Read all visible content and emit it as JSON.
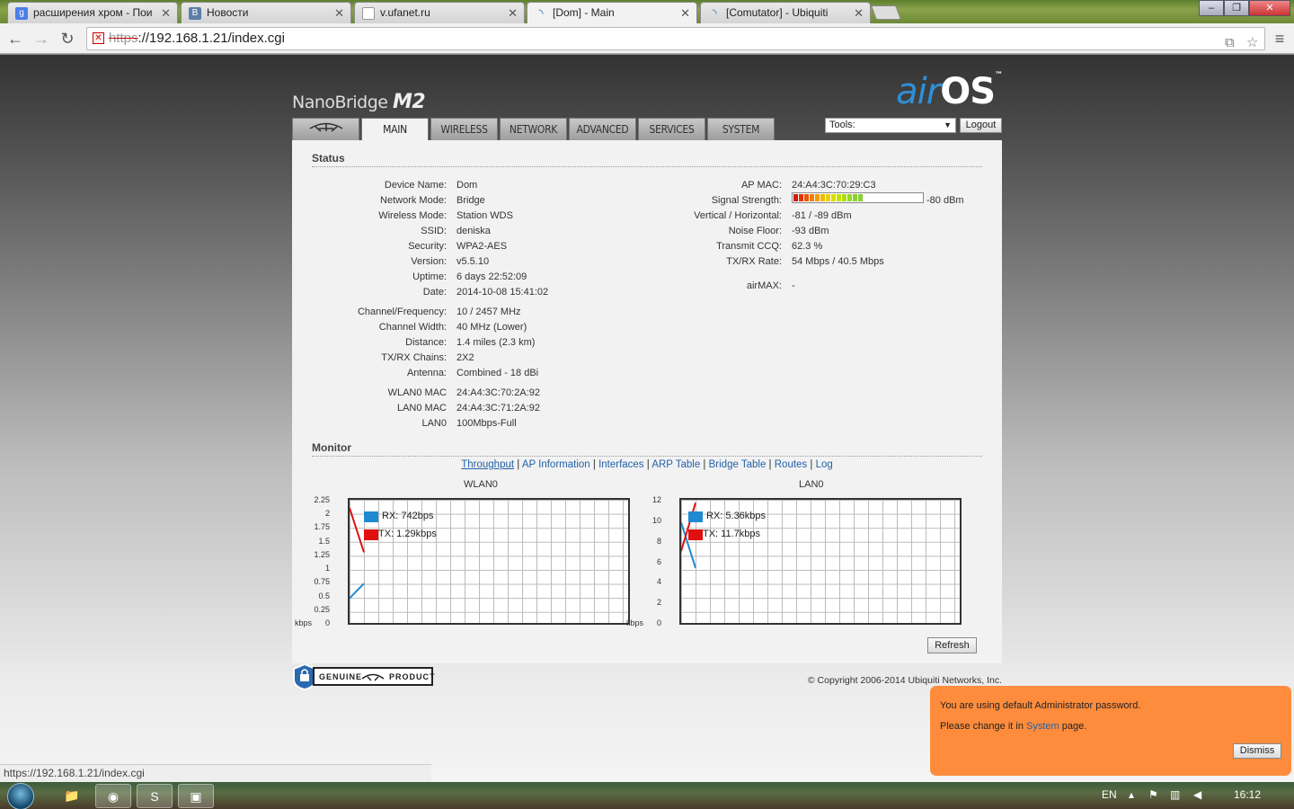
{
  "browser": {
    "tabs": [
      {
        "label": "расширения хром - Пои",
        "icon": "google-icon"
      },
      {
        "label": "Новости",
        "icon": "vk-icon"
      },
      {
        "label": "v.ufanet.ru",
        "icon": "page-icon"
      },
      {
        "label": "[Dom] - Main",
        "icon": "rss-icon",
        "active": true
      },
      {
        "label": "[Comutator] - Ubiquiti",
        "icon": "rss-icon"
      }
    ],
    "url_proto": "https",
    "url_rest": "://192.168.1.21/index.cgi",
    "status_url": "https://192.168.1.21/index.cgi"
  },
  "header": {
    "brand": "NanoBridge",
    "model": "M2",
    "logo_air": "air",
    "logo_os": "OS",
    "tm": "™"
  },
  "nav": {
    "tabs": [
      "MAIN",
      "WIRELESS",
      "NETWORK",
      "ADVANCED",
      "SERVICES",
      "SYSTEM"
    ],
    "tools": "Tools:",
    "logout": "Logout"
  },
  "status": {
    "title": "Status",
    "left": [
      {
        "label": "Device Name:",
        "value": "Dom"
      },
      {
        "label": "Network Mode:",
        "value": "Bridge"
      },
      {
        "label": "Wireless Mode:",
        "value": "Station WDS"
      },
      {
        "label": "SSID:",
        "value": "deniska"
      },
      {
        "label": "Security:",
        "value": "WPA2-AES"
      },
      {
        "label": "Version:",
        "value": "v5.5.10"
      },
      {
        "label": "Uptime:",
        "value": "6 days 22:52:09"
      },
      {
        "label": "Date:",
        "value": "2014-10-08 15:41:02"
      },
      {
        "label": "Channel/Frequency:",
        "value": "10 / 2457 MHz"
      },
      {
        "label": "Channel Width:",
        "value": "40 MHz (Lower)"
      },
      {
        "label": "Distance:",
        "value": "1.4 miles (2.3 km)"
      },
      {
        "label": "TX/RX Chains:",
        "value": "2X2"
      },
      {
        "label": "Antenna:",
        "value": "Combined - 18 dBi"
      },
      {
        "label": "WLAN0 MAC",
        "value": "24:A4:3C:70:2A:92"
      },
      {
        "label": "LAN0 MAC",
        "value": "24:A4:3C:71:2A:92"
      },
      {
        "label": "LAN0",
        "value": "100Mbps-Full"
      }
    ],
    "right": [
      {
        "label": "AP MAC:",
        "value": "24:A4:3C:70:29:C3"
      },
      {
        "label": "Signal Strength:",
        "value": "-80 dBm"
      },
      {
        "label": "Vertical / Horizontal:",
        "value": "-81 / -89 dBm"
      },
      {
        "label": "Noise Floor:",
        "value": "-93 dBm"
      },
      {
        "label": "Transmit CCQ:",
        "value": "62.3 %"
      },
      {
        "label": "TX/RX Rate:",
        "value": "54 Mbps / 40.5 Mbps"
      },
      {
        "label": "airMAX:",
        "value": "-"
      }
    ],
    "signal_level": 0.55
  },
  "monitor": {
    "title": "Monitor",
    "links": [
      "Throughput",
      "AP Information",
      "Interfaces",
      "ARP Table",
      "Bridge Table",
      "Routes",
      "Log"
    ],
    "refresh": "Refresh"
  },
  "chart_data": [
    {
      "type": "line",
      "title": "WLAN0",
      "ylabel": "kbps",
      "yticks": [
        "2.25",
        "2",
        "1.75",
        "1.5",
        "1.25",
        "1",
        "0.75",
        "0.5",
        "0.25",
        "0"
      ],
      "ylim": [
        0,
        2.25
      ],
      "series": [
        {
          "name": "RX: 742bps",
          "color": "#1f8ad0",
          "values": [
            0.45,
            0.72
          ]
        },
        {
          "name": "TX: 1.29kbps",
          "color": "#e01010",
          "values": [
            2.1,
            1.29
          ]
        }
      ]
    },
    {
      "type": "line",
      "title": "LAN0",
      "ylabel": "kbps",
      "yticks": [
        "12",
        "10",
        "8",
        "6",
        "4",
        "2",
        "0"
      ],
      "ylim": [
        0,
        12
      ],
      "series": [
        {
          "name": "RX: 5.36kbps",
          "color": "#1f8ad0",
          "values": [
            9.8,
            5.36
          ]
        },
        {
          "name": "TX: 11.7kbps",
          "color": "#e01010",
          "values": [
            7.0,
            11.7
          ]
        }
      ]
    }
  ],
  "footer": {
    "copyright": "© Copyright 2006-2014 Ubiquiti Networks, Inc.",
    "genuine_left": "GENUINE",
    "genuine_right": "PRODUCT"
  },
  "notice": {
    "line1": "You are using default Administrator password.",
    "line2_pre": "Please change it in ",
    "line2_link": "System",
    "line2_post": " page.",
    "dismiss": "Dismiss"
  },
  "taskbar": {
    "lang": "EN",
    "time": "16:12"
  }
}
